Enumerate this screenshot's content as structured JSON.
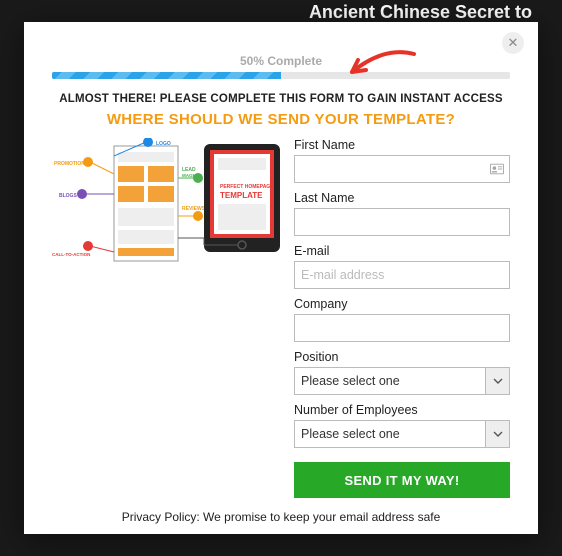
{
  "background": {
    "teaser_text": "Ancient Chinese Secret to"
  },
  "modal": {
    "progress": {
      "label": "50% Complete",
      "percent": 50
    },
    "instructions_line1": "ALMOST THERE! PLEASE COMPLETE THIS FORM TO GAIN INSTANT ACCESS",
    "instructions_line2": "WHERE SHOULD WE SEND YOUR TEMPLATE?",
    "hero": {
      "badges": [
        "LOGO",
        "PROMOTION",
        "LEAD MAGNET",
        "BLOGS",
        "REVIEWS",
        "CALL-TO-ACTION"
      ],
      "tablet_title_line1": "PERFECT HOMEPAGE",
      "tablet_title_line2": "TEMPLATE"
    },
    "form": {
      "first_name": {
        "label": "First Name",
        "value": ""
      },
      "last_name": {
        "label": "Last Name",
        "value": ""
      },
      "email": {
        "label": "E-mail",
        "placeholder": "E-mail address",
        "value": ""
      },
      "company": {
        "label": "Company",
        "value": ""
      },
      "position": {
        "label": "Position",
        "selected": "Please select one"
      },
      "employees": {
        "label": "Number of Employees",
        "selected": "Please select one"
      },
      "submit_label": "SEND IT MY WAY!"
    },
    "privacy": "Privacy Policy: We  promise to keep your email address safe"
  },
  "annotation": {
    "arrow_color": "#e6332a"
  }
}
